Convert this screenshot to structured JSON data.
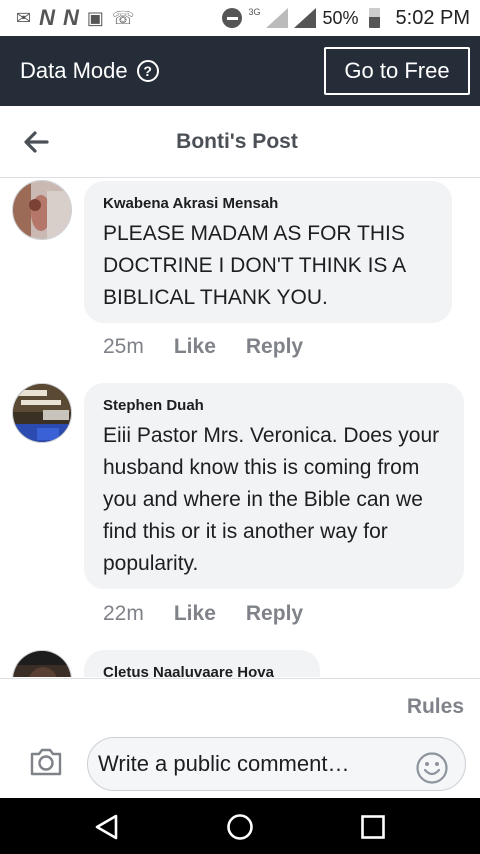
{
  "status_bar": {
    "network_label": "3G",
    "battery": "50%",
    "time": "5:02 PM",
    "icons": [
      "messenger-icon",
      "n-icon",
      "n-icon",
      "gallery-icon",
      "whatsapp-icon",
      "do-not-disturb-icon",
      "signal-icon",
      "battery-icon"
    ]
  },
  "data_mode_bar": {
    "label": "Data Mode",
    "info_icon": "?",
    "go_free_label": "Go to Free"
  },
  "header": {
    "title": "Bonti's Post",
    "back_icon": "arrow-left-icon"
  },
  "comments": [
    {
      "author": "Kwabena Akrasi Mensah",
      "text": "PLEASE MADAM AS FOR THIS DOCTRINE I DON'T THINK IS A BIBLICAL THANK YOU.",
      "time": "25m",
      "like_label": "Like",
      "reply_label": "Reply"
    },
    {
      "author": "Stephen Duah",
      "text": "Eiii Pastor Mrs. Veronica.  Does your husband know this is coming from you and where in the Bible can we find this or it is another way for popularity.",
      "time": "22m",
      "like_label": "Like",
      "reply_label": "Reply"
    },
    {
      "author": "Cletus Naaluvaare Hova"
    }
  ],
  "footer": {
    "rules_label": "Rules",
    "comment_placeholder": "Write a public comment…",
    "camera_icon": "camera-icon",
    "emoji_icon": "emoji-icon"
  },
  "colors": {
    "data_bar_bg": "#252d38",
    "bubble_bg": "#f2f3f5",
    "meta_text": "#7f8288",
    "title_text": "#4b4f56"
  }
}
